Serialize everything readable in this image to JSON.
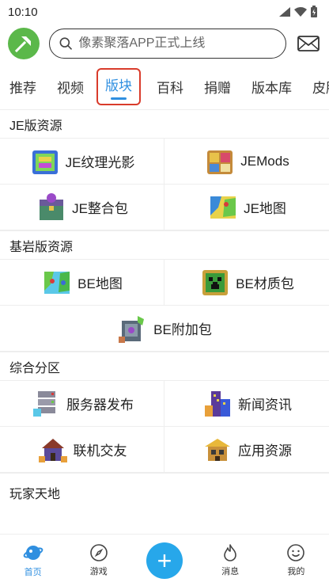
{
  "status_bar": {
    "time": "10:10"
  },
  "search": {
    "placeholder": "像素聚落APP正式上线"
  },
  "tabs": [
    {
      "label": "推荐"
    },
    {
      "label": "视频"
    },
    {
      "label": "版块"
    },
    {
      "label": "百科"
    },
    {
      "label": "捐赠"
    },
    {
      "label": "版本库"
    },
    {
      "label": "皮肤小"
    }
  ],
  "sections": [
    {
      "title": "JE版资源",
      "items": [
        {
          "label": "JE纹理光影"
        },
        {
          "label": "JEMods"
        },
        {
          "label": "JE整合包"
        },
        {
          "label": "JE地图"
        }
      ]
    },
    {
      "title": "基岩版资源",
      "items": [
        {
          "label": "BE地图"
        },
        {
          "label": "BE材质包"
        },
        {
          "label": "BE附加包"
        }
      ]
    },
    {
      "title": "综合分区",
      "items": [
        {
          "label": "服务器发布"
        },
        {
          "label": "新闻资讯"
        },
        {
          "label": "联机交友"
        },
        {
          "label": "应用资源"
        }
      ]
    },
    {
      "title": "玩家天地"
    }
  ],
  "bottom_nav": [
    {
      "label": "首页"
    },
    {
      "label": "游戏"
    },
    {
      "label": "+"
    },
    {
      "label": "消息"
    },
    {
      "label": "我的"
    }
  ],
  "colors": {
    "accent": "#2f8fe0",
    "highlight_box": "#d93b2b",
    "plus_button": "#27a7ea",
    "logo_bg": "#5bb84a"
  }
}
